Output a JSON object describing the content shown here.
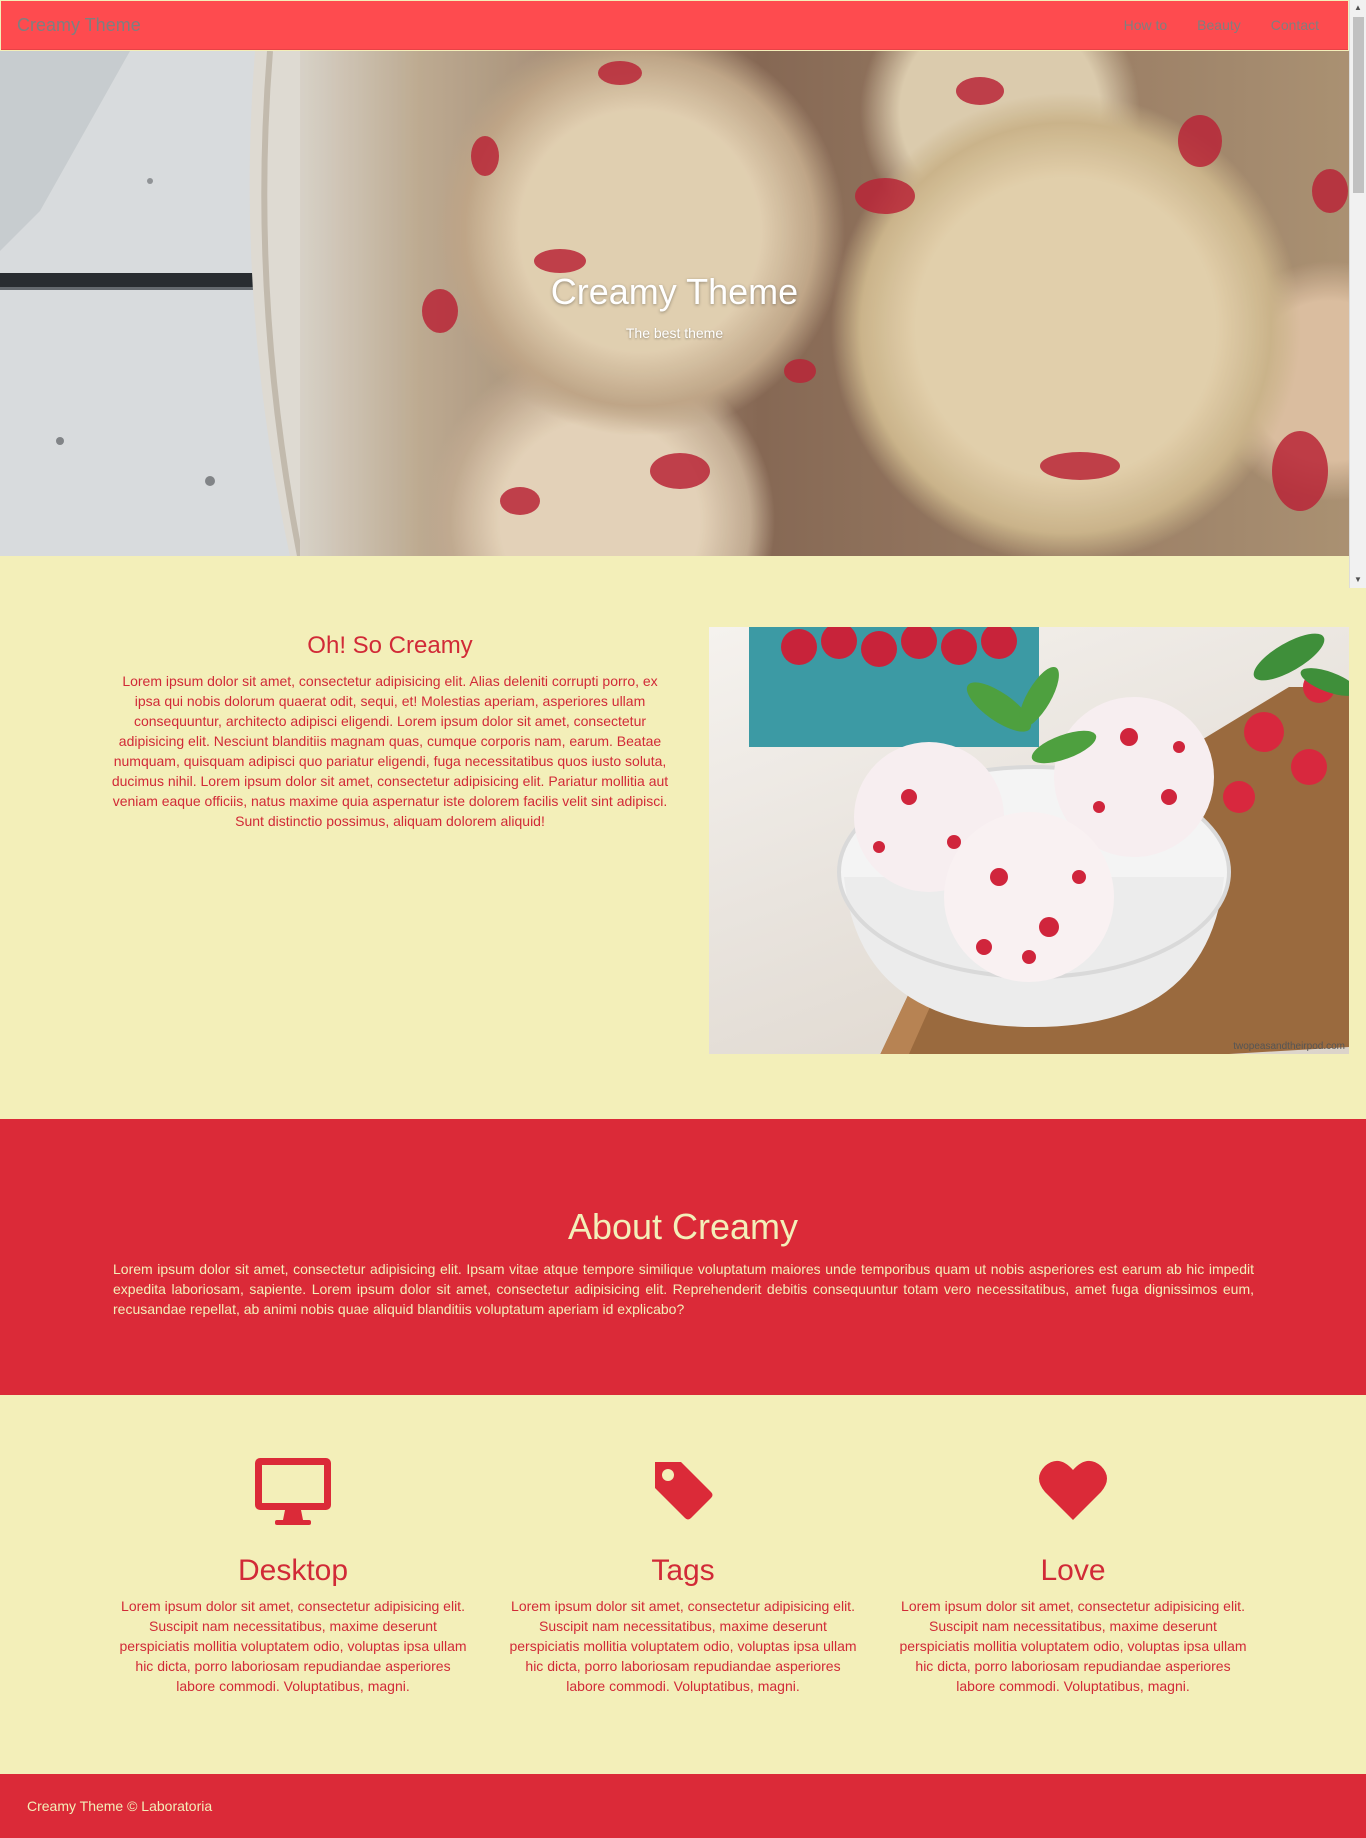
{
  "navbar": {
    "brand": "Creamy Theme",
    "links": [
      "How to",
      "Beauty",
      "Contact"
    ]
  },
  "hero": {
    "title": "Creamy Theme",
    "subtitle": "The best theme"
  },
  "intro": {
    "title": "Oh! So Creamy",
    "text": "Lorem ipsum dolor sit amet, consectetur adipisicing elit. Alias deleniti corrupti porro, ex ipsa qui nobis dolorum quaerat odit, sequi, et! Molestias aperiam, asperiores ullam consequuntur, architecto adipisci eligendi. Lorem ipsum dolor sit amet, consectetur adipisicing elit. Nesciunt blanditiis magnam quas, cumque corporis nam, earum. Beatae numquam, quisquam adipisci quo pariatur eligendi, fuga necessitatibus quos iusto soluta, ducimus nihil. Lorem ipsum dolor sit amet, consectetur adipisicing elit. Pariatur mollitia aut veniam eaque officiis, natus maxime quia aspernatur iste dolorem facilis velit sint adipisci. Sunt distinctio possimus, aliquam dolorem aliquid!",
    "image_credit": "twopeasandtheirpod.com"
  },
  "about": {
    "title": "About Creamy",
    "text": "Lorem ipsum dolor sit amet, consectetur adipisicing elit. Ipsam vitae atque tempore similique voluptatum maiores unde temporibus quam ut nobis asperiores est earum ab hic impedit expedita laboriosam, sapiente. Lorem ipsum dolor sit amet, consectetur adipisicing elit. Reprehenderit debitis consequuntur totam vero necessitatibus, amet fuga dignissimos eum, recusandae repellat, ab animi nobis quae aliquid blanditiis voluptatum aperiam id explicabo?"
  },
  "features": [
    {
      "icon": "desktop-icon",
      "title": "Desktop",
      "text": "Lorem ipsum dolor sit amet, consectetur adipisicing elit. Suscipit nam necessitatibus, maxime deserunt perspiciatis mollitia voluptatem odio, voluptas ipsa ullam hic dicta, porro laboriosam repudiandae asperiores labore commodi. Voluptatibus, magni."
    },
    {
      "icon": "tag-icon",
      "title": "Tags",
      "text": "Lorem ipsum dolor sit amet, consectetur adipisicing elit. Suscipit nam necessitatibus, maxime deserunt perspiciatis mollitia voluptatem odio, voluptas ipsa ullam hic dicta, porro laboriosam repudiandae asperiores labore commodi. Voluptatibus, magni."
    },
    {
      "icon": "heart-icon",
      "title": "Love",
      "text": "Lorem ipsum dolor sit amet, consectetur adipisicing elit. Suscipit nam necessitatibus, maxime deserunt perspiciatis mollitia voluptatem odio, voluptas ipsa ullam hic dicta, porro laboriosam repudiandae asperiores labore commodi. Voluptatibus, magni."
    }
  ],
  "footer": {
    "text": "Creamy Theme © Laboratoria"
  },
  "colors": {
    "navbar": "#fe4b4f",
    "accent_red": "#db2a38",
    "text_red": "#d12a37",
    "cream": "#f3efb9"
  }
}
